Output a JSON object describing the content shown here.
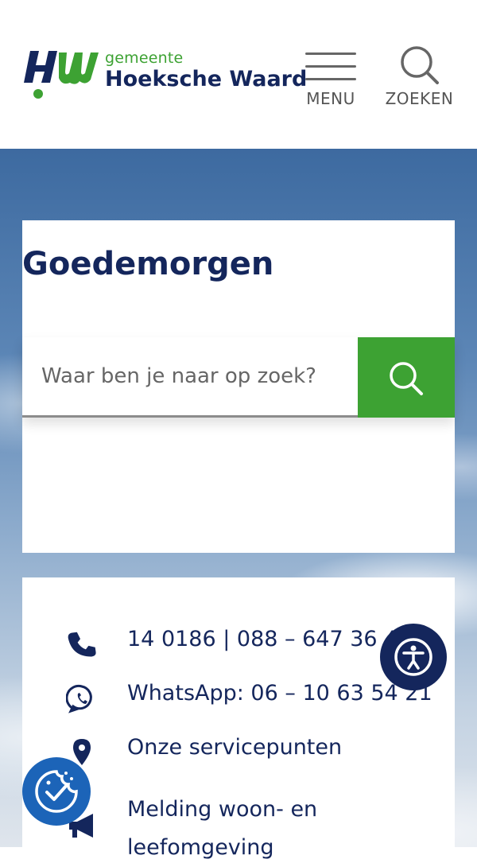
{
  "header": {
    "logo_sub": "gemeente",
    "logo_main": "Hoeksche Waard",
    "menu_label": "MENU",
    "search_label": "ZOEKEN"
  },
  "hero": {
    "greeting": "Goedemorgen",
    "search_placeholder": "Waar ben je naar op zoek?"
  },
  "contact": {
    "items": [
      {
        "icon": "phone-icon",
        "label": "14 0186 | 088 – 647 36 47"
      },
      {
        "icon": "whatsapp-icon",
        "label": "WhatsApp: 06 – 10 63 54 21"
      },
      {
        "icon": "location-pin-icon",
        "label": "Onze servicepunten"
      },
      {
        "icon": "megaphone-icon",
        "label": "Melding woon- en leefomgeving"
      }
    ]
  },
  "colors": {
    "brand_navy": "#14265c",
    "brand_green": "#3da233",
    "cookie_blue": "#1c64b8"
  }
}
